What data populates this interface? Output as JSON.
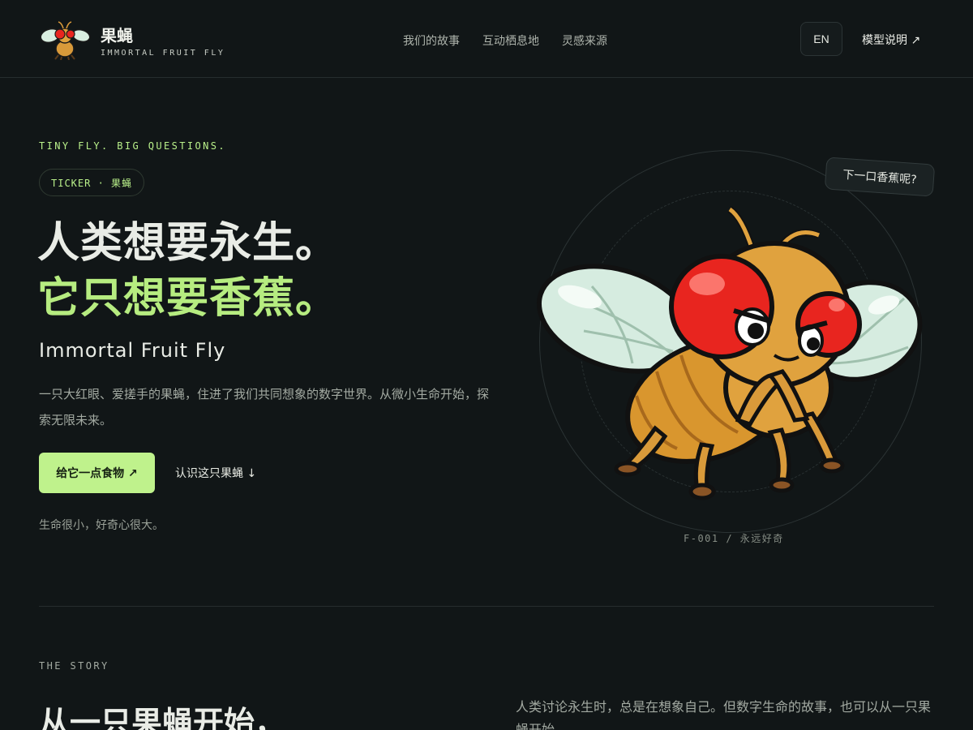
{
  "header": {
    "brand_name": "果蝇",
    "brand_sub": "IMMORTAL FRUIT FLY",
    "nav": [
      {
        "label": "我们的故事"
      },
      {
        "label": "互动栖息地"
      },
      {
        "label": "灵感来源"
      }
    ],
    "lang_button": "EN",
    "model_link": "模型说明 ↗"
  },
  "hero": {
    "eyebrow": "TINY FLY. BIG QUESTIONS.",
    "ticker": "TICKER · 果蝇",
    "title_line1": "人类想要永生。",
    "title_line2": "它只想要香蕉。",
    "subtitle": "Immortal Fruit Fly",
    "description": "一只大红眼、爱搓手的果蝇，住进了我们共同想象的数字世界。从微小生命开始，探索无限未来。",
    "cta_primary": "给它一点食物 ↗",
    "cta_secondary": "认识这只果蝇 ↓",
    "tagline": "生命很小，好奇心很大。",
    "speech_bubble": "下一口香蕉呢?",
    "caption": "F-001 / 永远好奇"
  },
  "story": {
    "label": "THE STORY",
    "title": "从一只果蝇开始，",
    "text": "人类讨论永生时，总是在想象自己。但数字生命的故事，也可以从一只果蝇开始。"
  },
  "colors": {
    "background": "#111617",
    "accent_green": "#b6ec80",
    "button_green": "#bff28c",
    "text_primary": "#e9ece6",
    "text_muted": "#a3aaa2"
  },
  "icons": {
    "logo": "fruit-fly-mascot-icon",
    "hero": "fruit-fly-mascot-illustration"
  }
}
